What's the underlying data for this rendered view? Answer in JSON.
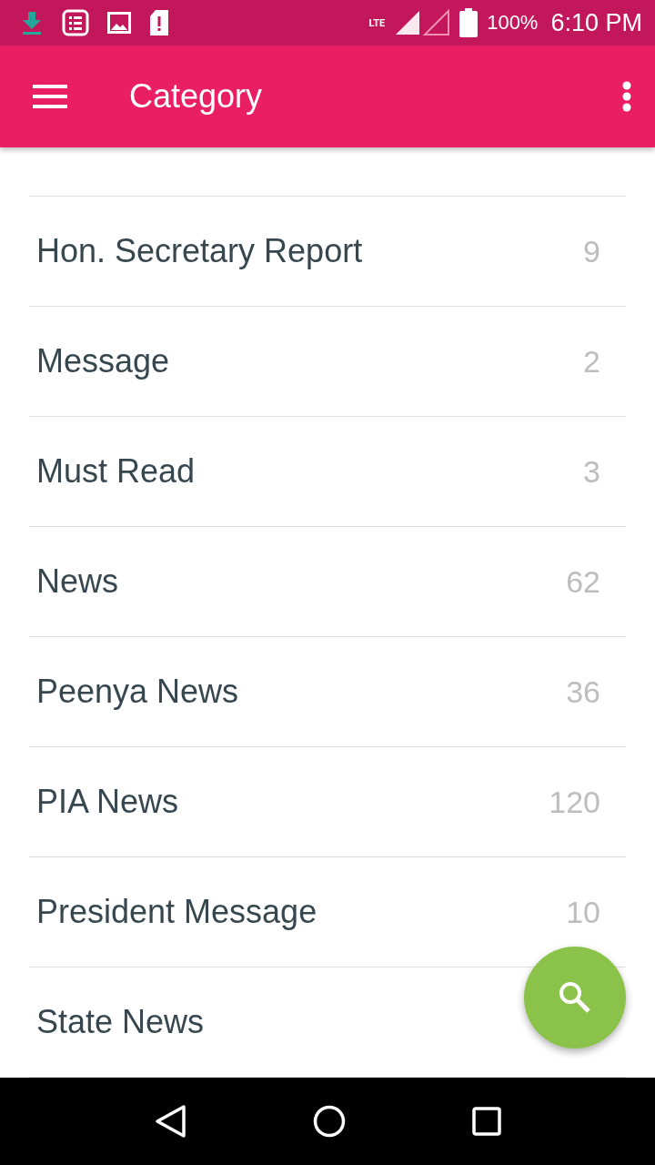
{
  "status_bar": {
    "network": "LTE",
    "battery": "100%",
    "time": "6:10 PM"
  },
  "app_bar": {
    "title": "Category"
  },
  "categories": [
    {
      "name": "Hon. Secretary Report",
      "count": "9"
    },
    {
      "name": "Message",
      "count": "2"
    },
    {
      "name": "Must Read",
      "count": "3"
    },
    {
      "name": "News",
      "count": "62"
    },
    {
      "name": "Peenya News",
      "count": "36"
    },
    {
      "name": "PIA News",
      "count": "120"
    },
    {
      "name": "President Message",
      "count": "10"
    },
    {
      "name": "State News"
    }
  ]
}
